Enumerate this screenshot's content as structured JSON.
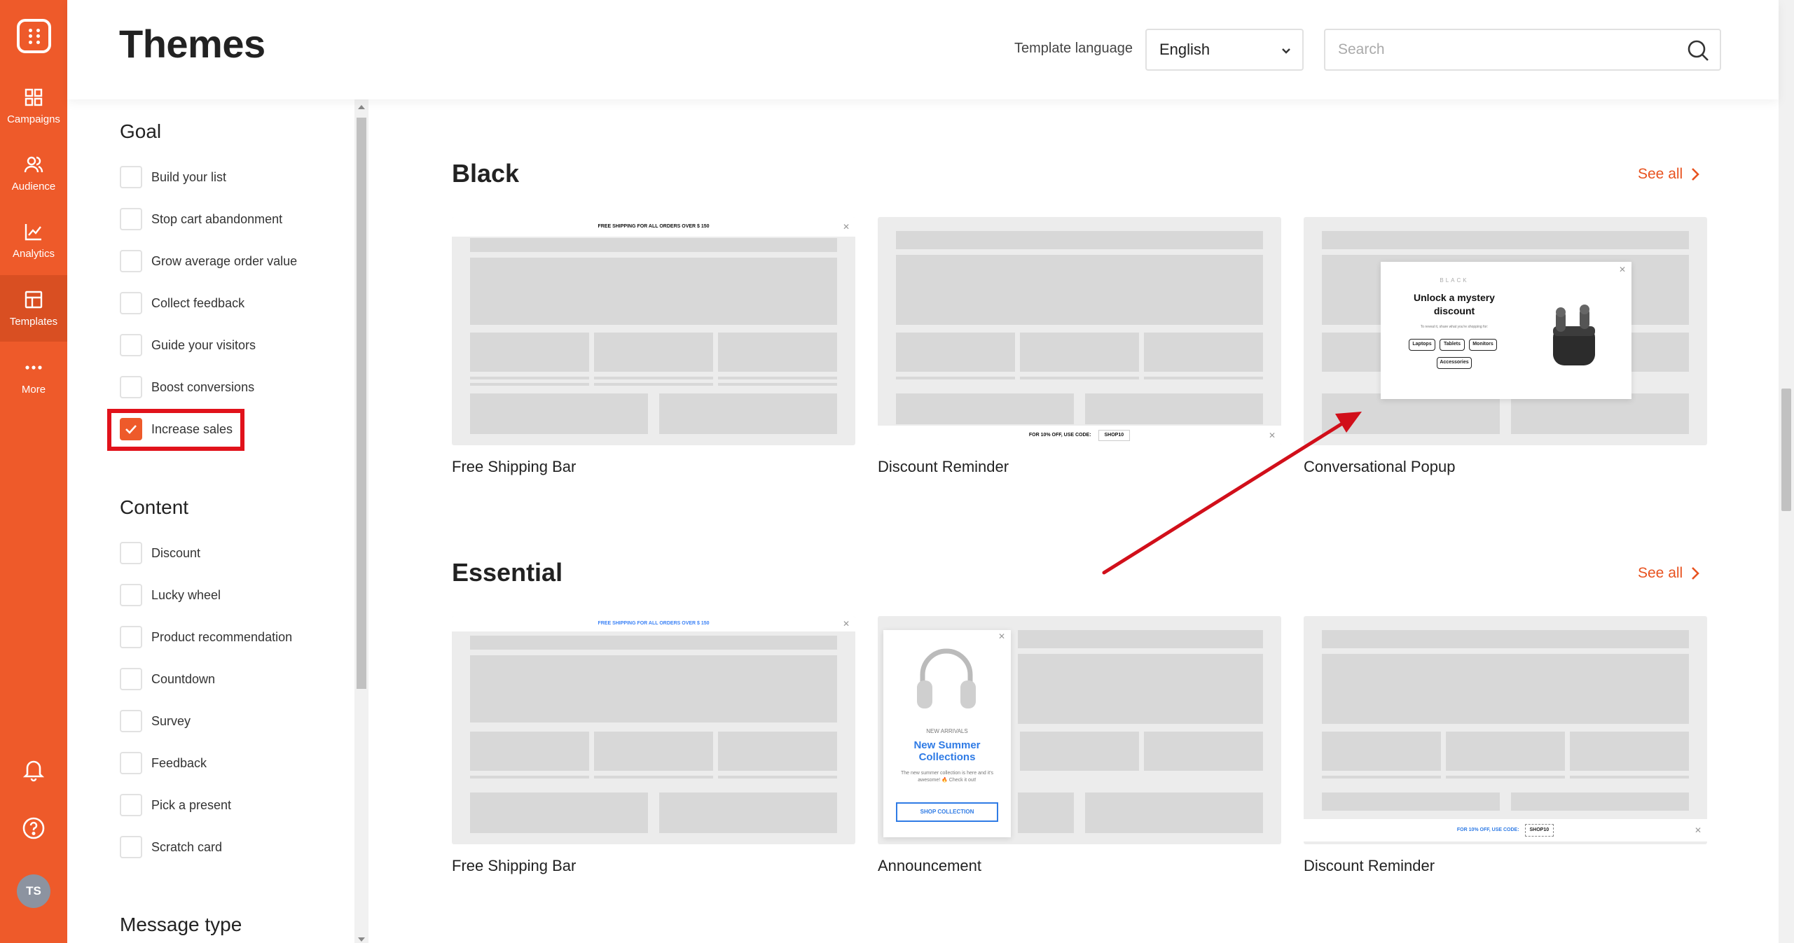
{
  "nav": {
    "items": [
      {
        "label": "Campaigns"
      },
      {
        "label": "Audience"
      },
      {
        "label": "Analytics"
      },
      {
        "label": "Templates"
      },
      {
        "label": "More"
      }
    ],
    "avatar_initials": "TS",
    "accent": "#ee5a2a"
  },
  "header": {
    "title": "Themes",
    "template_language_label": "Template language",
    "language_value": "English",
    "search_placeholder": "Search"
  },
  "filters": {
    "goal_heading": "Goal",
    "goal_items": [
      {
        "label": "Build your list",
        "checked": false
      },
      {
        "label": "Stop cart abandonment",
        "checked": false
      },
      {
        "label": "Grow average order value",
        "checked": false
      },
      {
        "label": "Collect feedback",
        "checked": false
      },
      {
        "label": "Guide your visitors",
        "checked": false
      },
      {
        "label": "Boost conversions",
        "checked": false
      },
      {
        "label": "Increase sales",
        "checked": true
      }
    ],
    "content_heading": "Content",
    "content_items": [
      {
        "label": "Discount",
        "checked": false
      },
      {
        "label": "Lucky wheel",
        "checked": false
      },
      {
        "label": "Product recommendation",
        "checked": false
      },
      {
        "label": "Countdown",
        "checked": false
      },
      {
        "label": "Survey",
        "checked": false
      },
      {
        "label": "Feedback",
        "checked": false
      },
      {
        "label": "Pick a present",
        "checked": false
      },
      {
        "label": "Scratch card",
        "checked": false
      }
    ],
    "message_type_heading": "Message type"
  },
  "sections": [
    {
      "title": "Black",
      "see_all": "See all",
      "cards": [
        {
          "title": "Free Shipping Bar",
          "bar_text": "FREE SHIPPING FOR ALL ORDERS OVER $ 150"
        },
        {
          "title": "Discount Reminder",
          "bar_text": "FOR 10% OFF, USE CODE:",
          "code": "SHOP10"
        },
        {
          "title": "Conversational Popup",
          "popup_brand": "BLACK",
          "popup_headline": "Unlock a mystery discount",
          "popup_sub": "To reveal it, share what you're shopping for:",
          "popup_options": [
            "Laptops",
            "Tablets",
            "Monitors",
            "Accessories"
          ]
        }
      ]
    },
    {
      "title": "Essential",
      "see_all": "See all",
      "cards": [
        {
          "title": "Free Shipping Bar",
          "bar_text": "FREE SHIPPING FOR ALL ORDERS OVER $ 150"
        },
        {
          "title": "Announcement",
          "popup_kicker": "NEW ARRIVALS",
          "popup_headline": "New Summer Collections",
          "popup_sub": "The new summer collection is here and it's awesome! 🔥 Check it out!",
          "popup_button": "SHOP COLLECTION"
        },
        {
          "title": "Discount Reminder",
          "bar_text": "FOR 10% OFF, USE CODE:",
          "code": "SHOP10"
        }
      ]
    }
  ]
}
